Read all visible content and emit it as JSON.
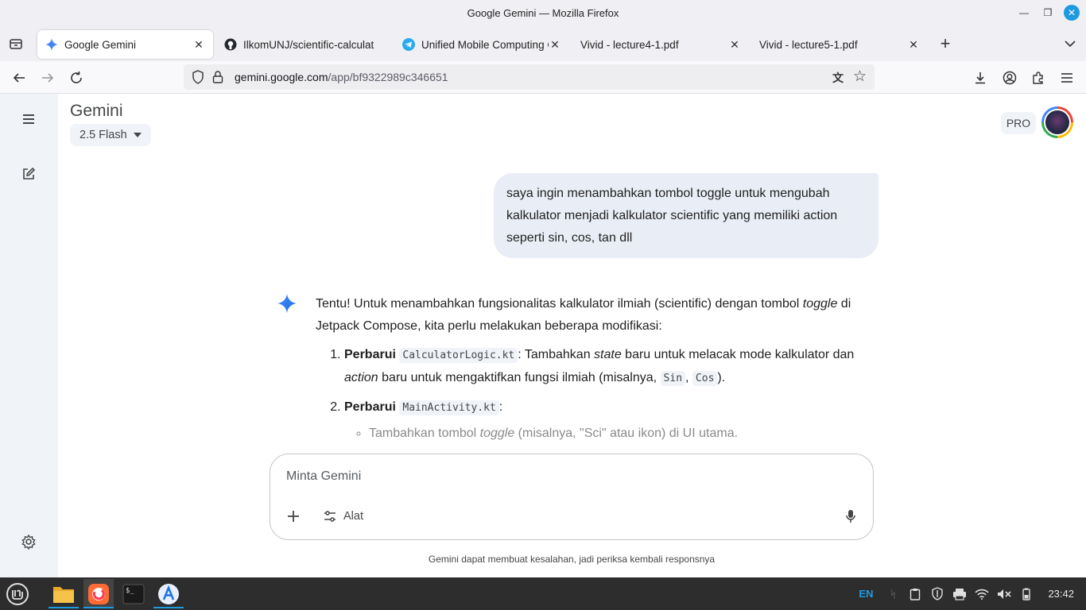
{
  "window": {
    "title": "Google Gemini — Mozilla Firefox"
  },
  "tabs": [
    {
      "label": "Google Gemini",
      "active": true
    },
    {
      "label": "IlkomUNJ/scientific-calculat",
      "active": false
    },
    {
      "label": "Unified Mobile Computing C",
      "active": false
    },
    {
      "label": "Vivid - lecture4-1.pdf",
      "active": false
    },
    {
      "label": "Vivid - lecture5-1.pdf",
      "active": false
    }
  ],
  "urlbar": {
    "host": "gemini.google.com",
    "path": "/app/bf9322989c346651"
  },
  "gemini": {
    "title": "Gemini",
    "model": "2.5 Flash",
    "plan_badge": "PRO"
  },
  "user_message": "saya ingin menambahkan tombol toggle untuk mengubah kalkulator menjadi kalkulator scientific yang memiliki action seperti sin, cos, tan dll",
  "response": {
    "intro_1": "Tentu! Untuk menambahkan fungsionalitas kalkulator ilmiah (scientific) dengan tombol ",
    "intro_em": "toggle",
    "intro_2": " di Jetpack Compose, kita perlu melakukan beberapa modifikasi:",
    "step1_bold": "Perbarui",
    "step1_code": "CalculatorLogic.kt",
    "step1_a": ": Tambahkan ",
    "step1_em1": "state",
    "step1_b": " baru untuk melacak mode kalkulator dan ",
    "step1_em2": "action",
    "step1_c": " baru untuk mengaktifkan fungsi ilmiah (misalnya, ",
    "step1_code2": "Sin",
    "step1_sep": ", ",
    "step1_code3": "Cos",
    "step1_end": ").",
    "step2_bold": "Perbarui",
    "step2_code": "MainActivity.kt",
    "step2_end": ":",
    "bullet_1": "Tambahkan tombol ",
    "bullet_em": "toggle",
    "bullet_2": " (misalnya, \"Sci\" atau ikon) di UI utama."
  },
  "input": {
    "placeholder": "Minta Gemini",
    "tools_label": "Alat"
  },
  "disclaimer": "Gemini dapat membuat kesalahan, jadi periksa kembali responsnya",
  "taskbar": {
    "lang": "EN",
    "clock": "23:42"
  },
  "colors": {
    "accent": "#1f9ae0",
    "sidebar": "#f0f4f9",
    "bubble": "#e9eef6",
    "spark": "#4285f4"
  }
}
